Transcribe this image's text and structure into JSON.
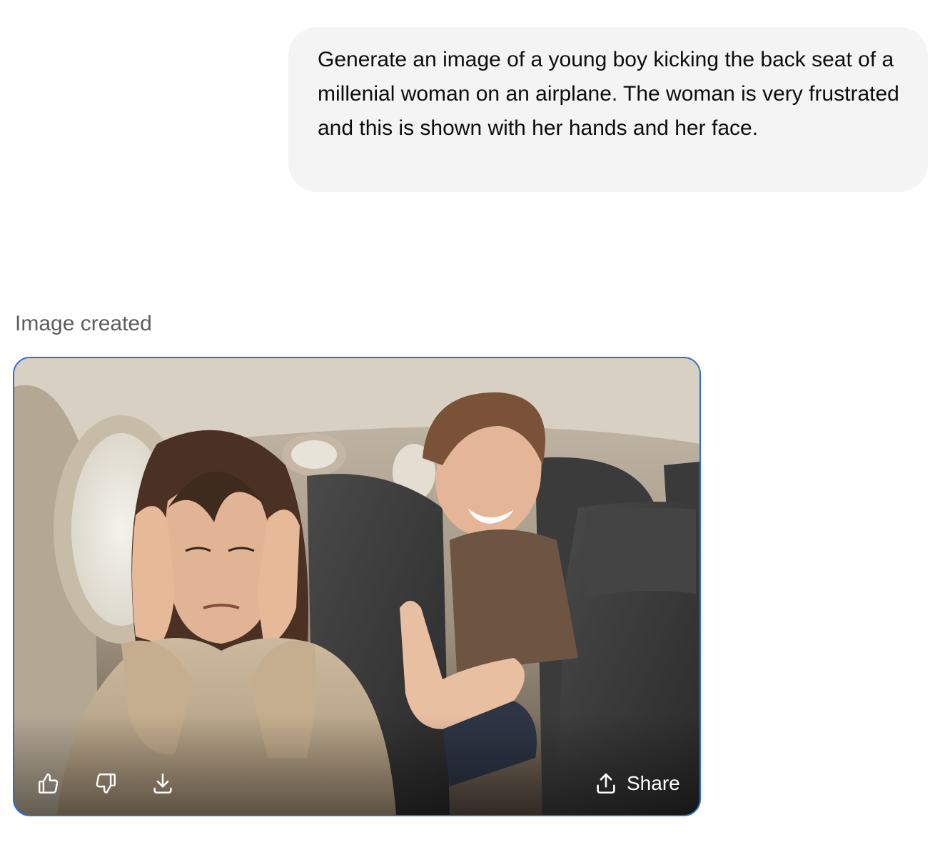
{
  "conversation": {
    "user_message": "Generate an image of a young boy kicking the back seat of a millenial woman on an airplane. The woman is very frustrated and this is shown with her hands and her face.",
    "assistant_status": "Image created"
  },
  "image_card": {
    "actions": {
      "like_icon": "thumbs-up-icon",
      "dislike_icon": "thumbs-down-icon",
      "download_icon": "download-icon",
      "share_icon": "share-icon",
      "share_label": "Share"
    }
  },
  "colors": {
    "bubble_bg": "#f4f4f4",
    "card_border": "#2f6fd1",
    "status_text": "#5d5d5d"
  }
}
